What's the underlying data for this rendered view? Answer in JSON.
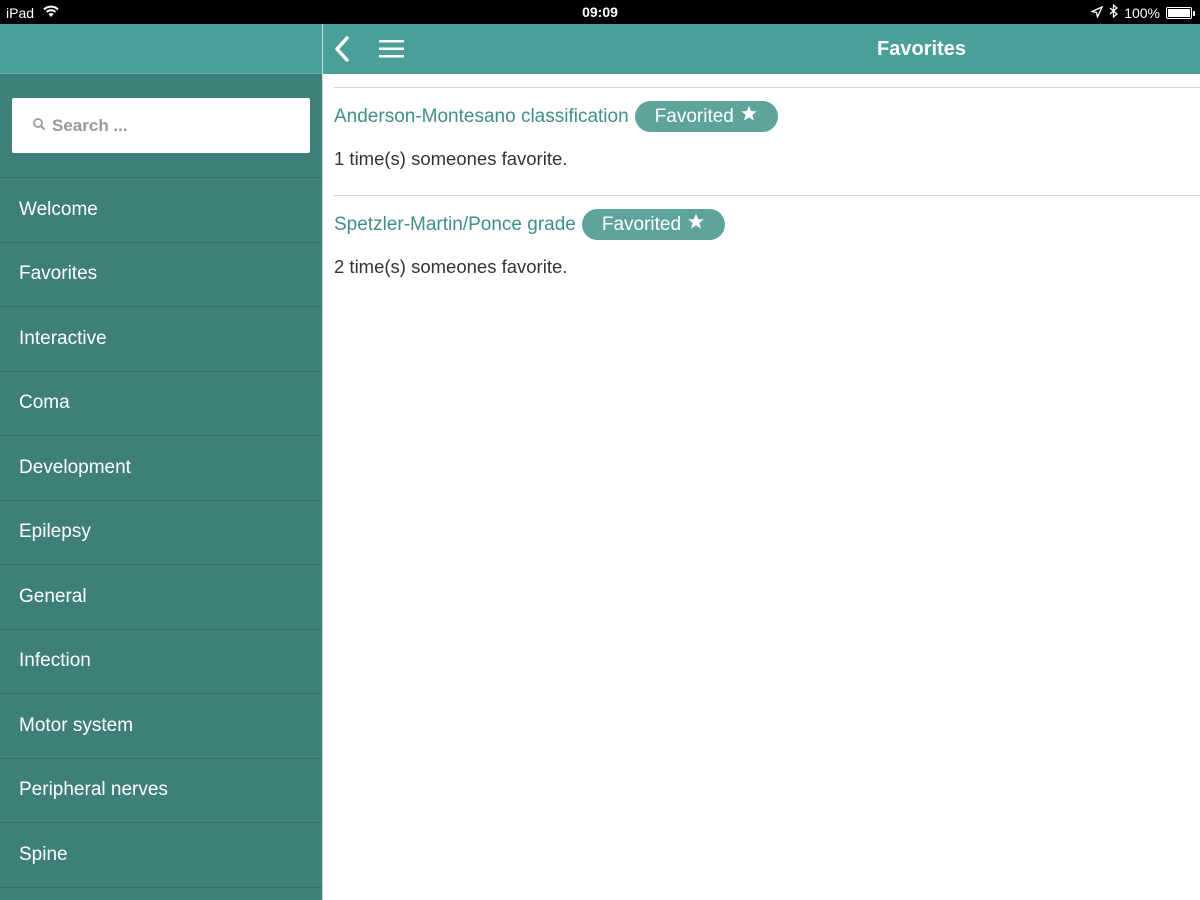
{
  "status_bar": {
    "device": "iPad",
    "time": "09:09",
    "battery": "100%"
  },
  "header": {
    "title": "Favorites"
  },
  "search": {
    "placeholder": "Search ..."
  },
  "sidebar": {
    "items": [
      {
        "label": "Welcome"
      },
      {
        "label": "Favorites"
      },
      {
        "label": "Interactive"
      },
      {
        "label": "Coma"
      },
      {
        "label": "Development"
      },
      {
        "label": "Epilepsy"
      },
      {
        "label": "General"
      },
      {
        "label": "Infection"
      },
      {
        "label": "Motor system"
      },
      {
        "label": "Peripheral nerves"
      },
      {
        "label": "Spine"
      }
    ]
  },
  "favorites": [
    {
      "title": "Anderson-Montesano classification",
      "badge": "Favorited",
      "meta": "1 time(s) someones favorite."
    },
    {
      "title": "Spetzler-Martin/Ponce grade",
      "badge": "Favorited",
      "meta": "2 time(s) someones favorite."
    }
  ],
  "colors": {
    "accent": "#4aa099",
    "sidebar": "#3e7f79",
    "link": "#3f8f88",
    "badge": "#5fa39d"
  },
  "icons": [
    "wifi-icon",
    "location-icon",
    "bluetooth-icon",
    "battery-icon",
    "search-icon",
    "back-icon",
    "menu-icon",
    "star-icon"
  ]
}
